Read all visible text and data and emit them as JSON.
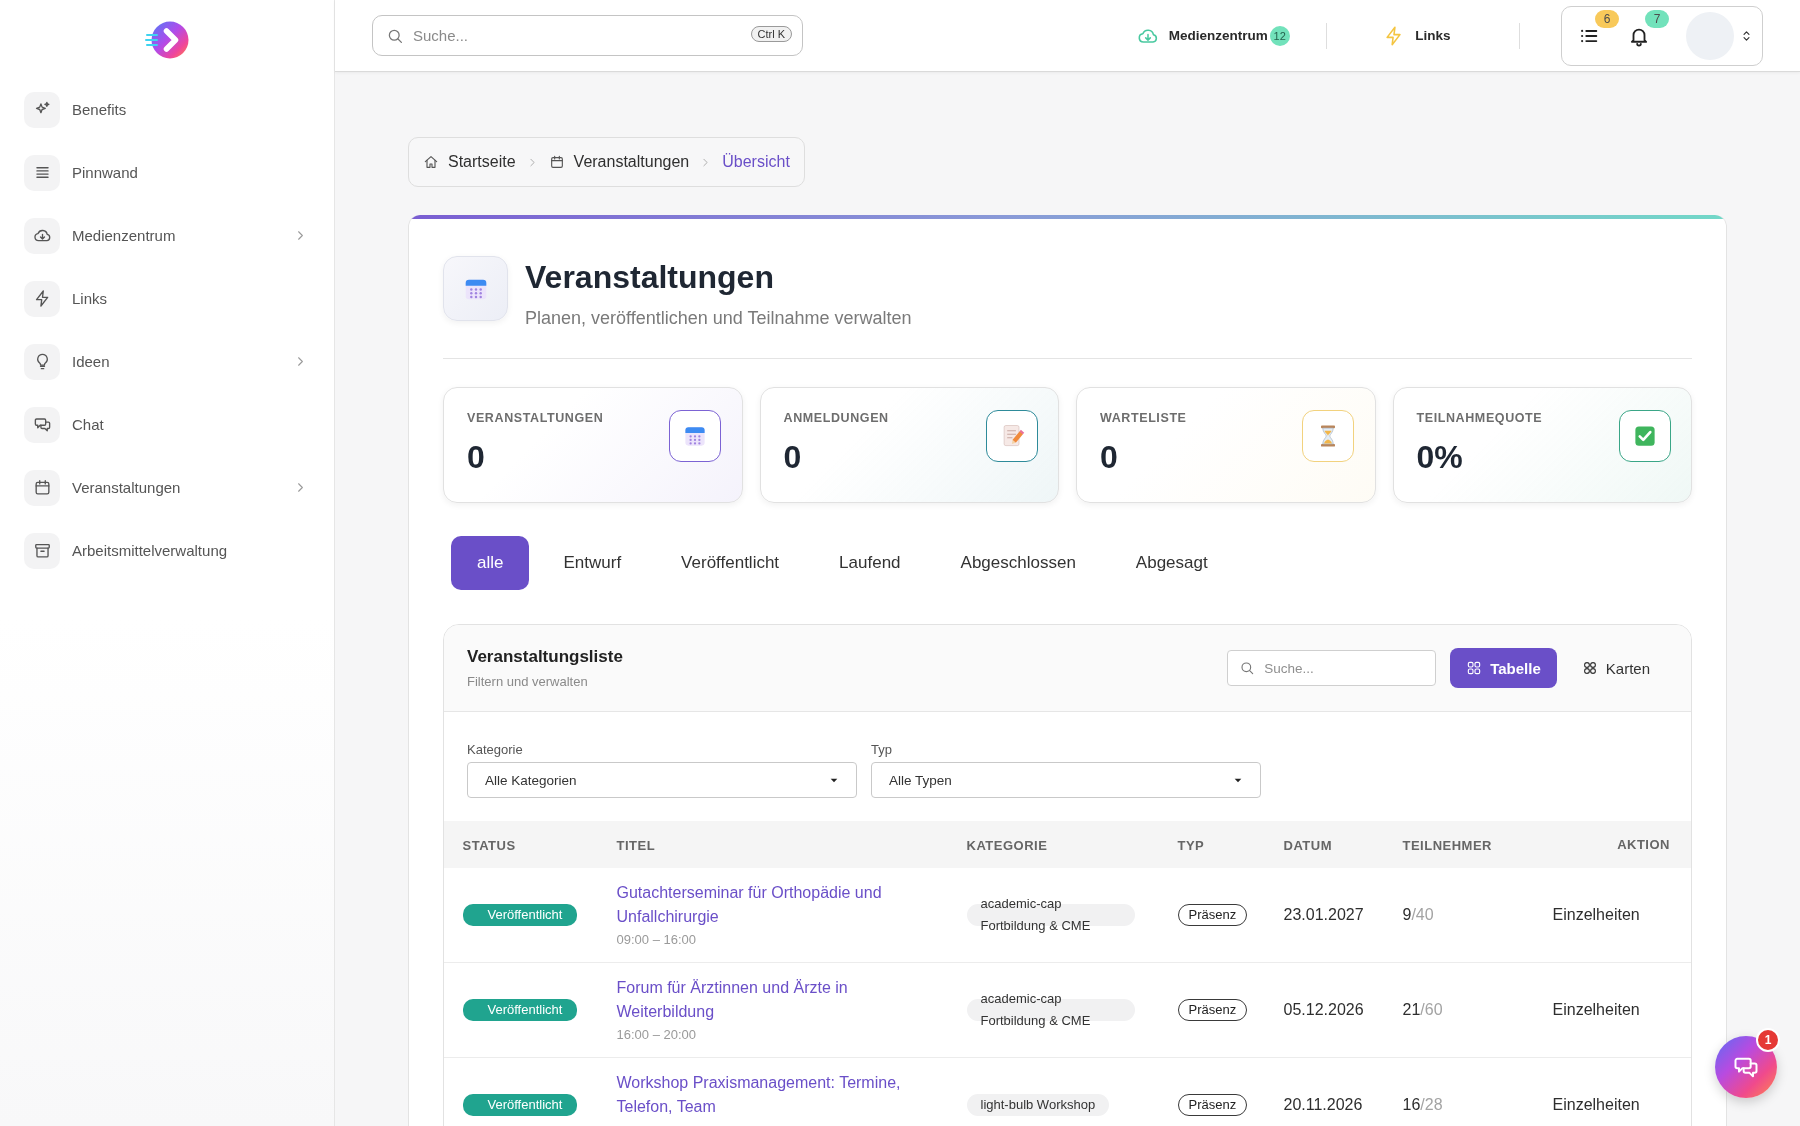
{
  "sidebar": {
    "items": [
      {
        "label": "Benefits",
        "expandable": false
      },
      {
        "label": "Pinnwand",
        "expandable": false
      },
      {
        "label": "Medienzentrum",
        "expandable": true
      },
      {
        "label": "Links",
        "expandable": false
      },
      {
        "label": "Ideen",
        "expandable": true
      },
      {
        "label": "Chat",
        "expandable": false
      },
      {
        "label": "Veranstaltungen",
        "expandable": true
      },
      {
        "label": "Arbeitsmittelverwaltung",
        "expandable": false
      }
    ]
  },
  "topbar": {
    "search": {
      "placeholder": "Suche...",
      "shortcut": "Ctrl K"
    },
    "shortcuts": [
      {
        "label": "Medienzentrum",
        "badge": "12"
      },
      {
        "label": "Links"
      }
    ],
    "actions": [
      {
        "badge": "6",
        "color": "#f8c95a"
      },
      {
        "badge": "7",
        "color": "#72e2bb"
      }
    ]
  },
  "breadcrumb": [
    {
      "label": "Startseite",
      "selected": false
    },
    {
      "label": "Veranstaltungen",
      "selected": false
    },
    {
      "label": "Übersicht",
      "selected": true
    }
  ],
  "header": {
    "title": "Veranstaltungen",
    "subtitle": "Planen, veröffentlichen und Teilnahme verwalten"
  },
  "stats": [
    {
      "label": "VERANSTALTUNGEN",
      "value": "0",
      "color": "#7c63d4"
    },
    {
      "label": "ANMELDUNGEN",
      "value": "0",
      "color": "#2e8b9a"
    },
    {
      "label": "WARTELISTE",
      "value": "0",
      "color": "#f2d27e"
    },
    {
      "label": "TEILNAHMEQUOTE",
      "value": "0%",
      "color": "#3aa687"
    }
  ],
  "tabs": [
    {
      "label": "alle",
      "selected": true
    },
    {
      "label": "Entwurf",
      "selected": false
    },
    {
      "label": "Veröffentlicht",
      "selected": false
    },
    {
      "label": "Laufend",
      "selected": false
    },
    {
      "label": "Abgeschlossen",
      "selected": false
    },
    {
      "label": "Abgesagt",
      "selected": false
    }
  ],
  "event_list": {
    "title": "Veranstaltungsliste",
    "subtitle": "Filtern und verwalten",
    "search": {
      "placeholder": "Suche..."
    },
    "views": [
      {
        "label": "Tabelle",
        "selected": true
      },
      {
        "label": "Karten",
        "selected": false
      }
    ],
    "filters": [
      {
        "label": "Kategorie",
        "value": "Alle Kategorien"
      },
      {
        "label": "Typ",
        "value": "Alle Typen"
      }
    ],
    "columns": [
      "STATUS",
      "TITEL",
      "KATEGORIE",
      "TYP",
      "DATUM",
      "TEILNEHMER",
      "AKTION"
    ],
    "rows": [
      {
        "status": "Veröffentlicht",
        "title": "Gutachterseminar für Orthopädie und Unfallchirurgie",
        "time": "09:00 – 16:00",
        "category": "academic-cap Fortbildung & CME",
        "type": "Präsenz",
        "date": "23.01.2027",
        "registered": "9",
        "capacity": "/40",
        "action": "Einzelheiten"
      },
      {
        "status": "Veröffentlicht",
        "title": "Forum für Ärztinnen und Ärzte in Weiterbildung",
        "time": "16:00 – 20:00",
        "category": "academic-cap Fortbildung & CME",
        "type": "Präsenz",
        "date": "05.12.2026",
        "registered": "21",
        "capacity": "/60",
        "action": "Einzelheiten"
      },
      {
        "status": "Veröffentlicht",
        "title": "Workshop Praxismanagement: Termine, Telefon, Team",
        "category": "light-bulb Workshop",
        "type": "Präsenz",
        "date": "20.11.2026",
        "registered": "16",
        "capacity": "/28",
        "action": "Einzelheiten"
      }
    ]
  },
  "chat_button": {
    "badge": "1"
  }
}
